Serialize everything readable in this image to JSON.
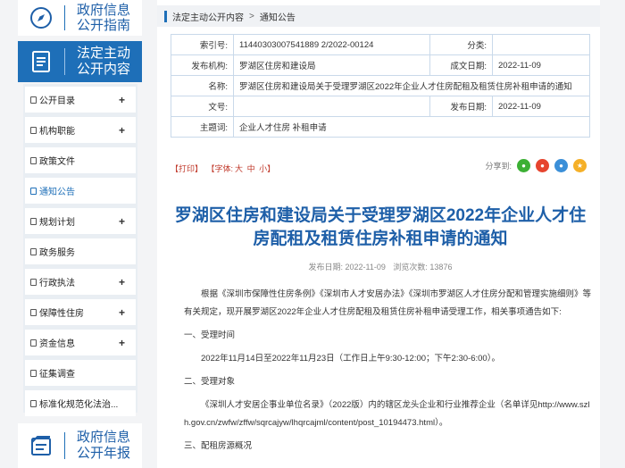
{
  "sidebar": {
    "gov_guide": {
      "line1": "政府信息",
      "line2": "公开指南",
      "icon": "compass-icon"
    },
    "active_section": {
      "line1": "法定主动",
      "line2": "公开内容",
      "icon": "document-list-icon"
    },
    "items": [
      {
        "label": "公开目录",
        "has_plus": "+"
      },
      {
        "label": "机构职能",
        "has_plus": "+"
      },
      {
        "label": "政策文件",
        "has_plus": ""
      },
      {
        "label": "通知公告",
        "has_plus": ""
      },
      {
        "label": "规划计划",
        "has_plus": "+"
      },
      {
        "label": "政务服务",
        "has_plus": ""
      },
      {
        "label": "行政执法",
        "has_plus": "+"
      },
      {
        "label": "保障性住房",
        "has_plus": "+"
      },
      {
        "label": "资金信息",
        "has_plus": "+"
      },
      {
        "label": "征集调查",
        "has_plus": ""
      },
      {
        "label": "标准化规范化法治...",
        "has_plus": ""
      }
    ],
    "annual_report": {
      "line1": "政府信息",
      "line2": "公开年报",
      "icon": "annual-report-icon"
    }
  },
  "breadcrumb": {
    "item1": "法定主动公开内容",
    "sep": ">",
    "item2": "通知公告"
  },
  "meta": {
    "index_label": "索引号:",
    "index_value": "11440303007541889 2/2022-00124",
    "category_label": "分类:",
    "category_value": "",
    "publisher_label": "发布机构:",
    "publisher_value": "罗湖区住房和建设局",
    "created_label": "成文日期:",
    "created_value": "2022-11-09",
    "name_label": "名称:",
    "name_value": "罗湖区住房和建设局关于受理罗湖区2022年企业人才住房配租及租赁住房补租申请的通知",
    "docno_label": "文号:",
    "docno_value": "",
    "pubdate_label": "发布日期:",
    "pubdate_value": "2022-11-09",
    "subject_label": "主题词:",
    "subject_value": "企业人才住房 补租申请"
  },
  "tools": {
    "print": "【打印】",
    "font": "【字体:",
    "big": "大",
    "mid": "中",
    "small": "小】",
    "share": "分享到:"
  },
  "article": {
    "title_line1": "罗湖区住房和建设局关于受理罗湖区2022年企业人才住",
    "title_line2": "房配租及租赁住房补租申请的通知",
    "pub_label": "发布日期: 2022-11-09",
    "views_label": "浏览次数: 13876",
    "p1": "根据《深圳市保障性住房条例》《深圳市人才安居办法》《深圳市罗湖区人才住房分配和管理实施细则》等有关规定，现开展罗湖区2022年企业人才住房配租及租赁住房补租申请受理工作，相关事项通告如下:",
    "h1": "一、受理时间",
    "p2": "2022年11月14日至2022年11月23日（工作日上午9:30-12:00；下午2:30-6:00）。",
    "h2": "二、受理对象",
    "p3": "《深圳人才安居企事业单位名录》（2022版）内的辖区龙头企业和行业推荐企业（名单详见http://www.szlh.gov.cn/zwfw/zffw/sqrcajyw/lhqrcajml/content/post_10194473.html）。",
    "h3": "三、配租房源概况"
  }
}
